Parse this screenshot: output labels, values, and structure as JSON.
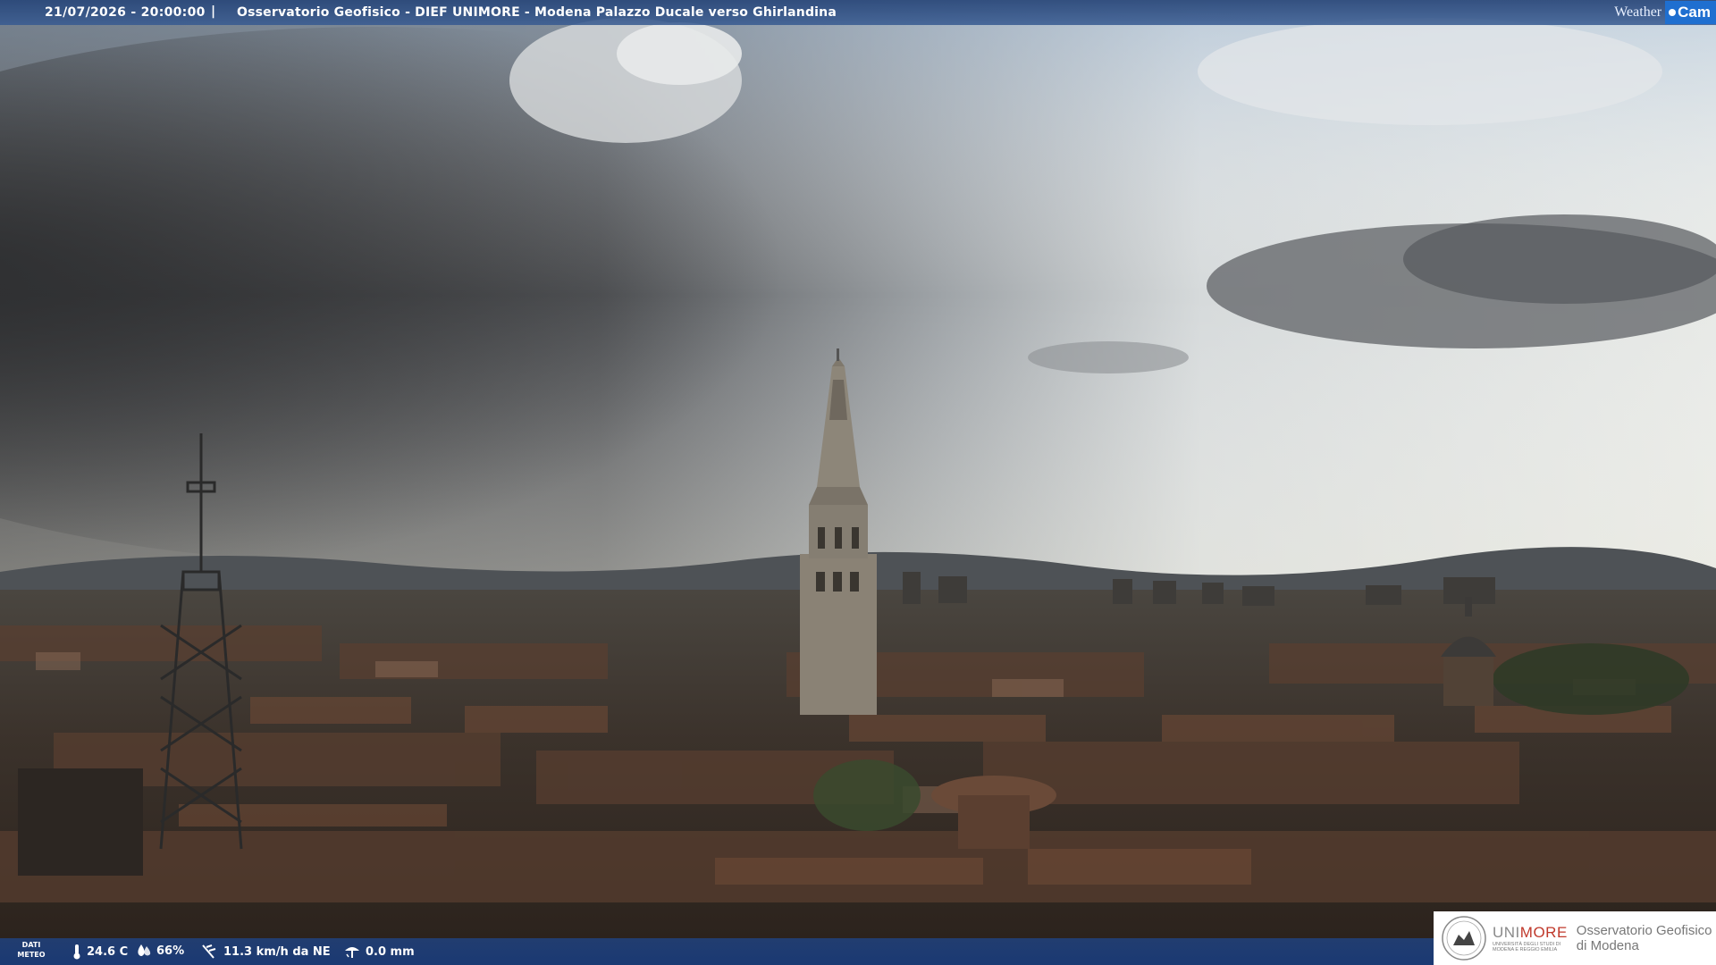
{
  "header": {
    "timestamp": "21/07/2026 - 20:00:00",
    "separator": "|",
    "station": "Osservatorio Geofisico - DIEF UNIMORE - Modena Palazzo Ducale verso Ghirlandina",
    "brand_part1": "Weather",
    "brand_part2": "Cam"
  },
  "weather": {
    "label_line1": "DATI",
    "label_line2": "METEO",
    "temperature": "24.6 C",
    "humidity": "66%",
    "wind": "11.3 km/h da NE",
    "rain": "0.0 mm",
    "icons": [
      "thermometer-icon",
      "humidity-drop-icon",
      "wind-icon",
      "rain-gauge-icon"
    ]
  },
  "logo": {
    "uni_part1": "UNI",
    "uni_part2": "MORE",
    "uni_subtitle": "UNIVERSITÀ DEGLI STUDI DI MODENA E REGGIO EMILIA",
    "observatory_line1": "Osservatorio Geofisico",
    "observatory_line2": "di Modena",
    "colors": {
      "uni_gray": "#8a8a8a",
      "more_red": "#c0392b"
    }
  },
  "colors": {
    "bar_blue": "#2c4a80",
    "brand_blue": "#1f6fd0"
  }
}
